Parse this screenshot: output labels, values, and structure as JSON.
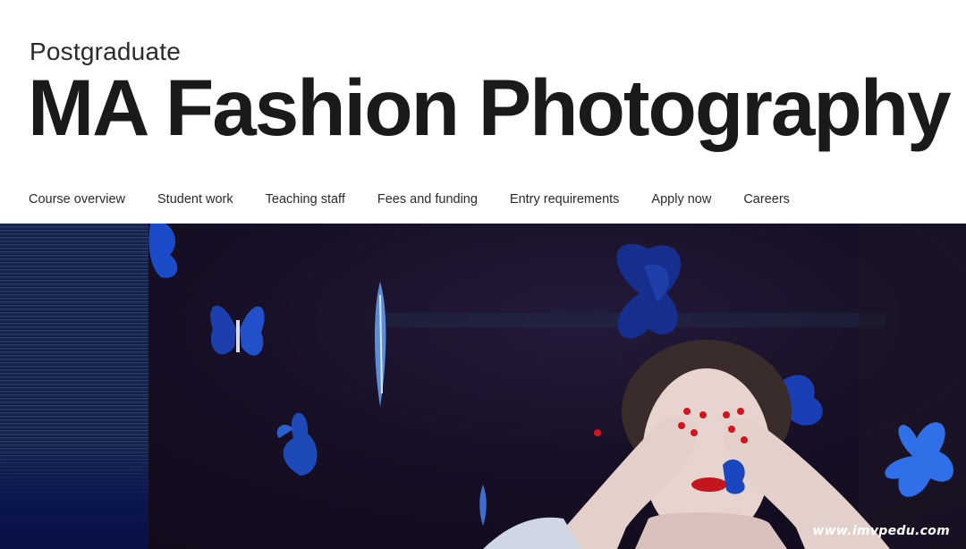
{
  "header": {
    "eyebrow": "Postgraduate",
    "title": "MA Fashion Photography"
  },
  "nav": {
    "items": [
      {
        "label": "Course overview"
      },
      {
        "label": "Student work"
      },
      {
        "label": "Teaching staff"
      },
      {
        "label": "Fees and funding"
      },
      {
        "label": "Entry requirements"
      },
      {
        "label": "Apply now"
      },
      {
        "label": "Careers"
      }
    ]
  },
  "hero": {
    "watermark": "www.imvpedu.com"
  },
  "colors": {
    "text": "#1a1a1a",
    "background": "#ffffff",
    "hero_dark": "#170f25",
    "butterfly_blue": "#1f4fd6",
    "lip_red": "#c4161c"
  }
}
